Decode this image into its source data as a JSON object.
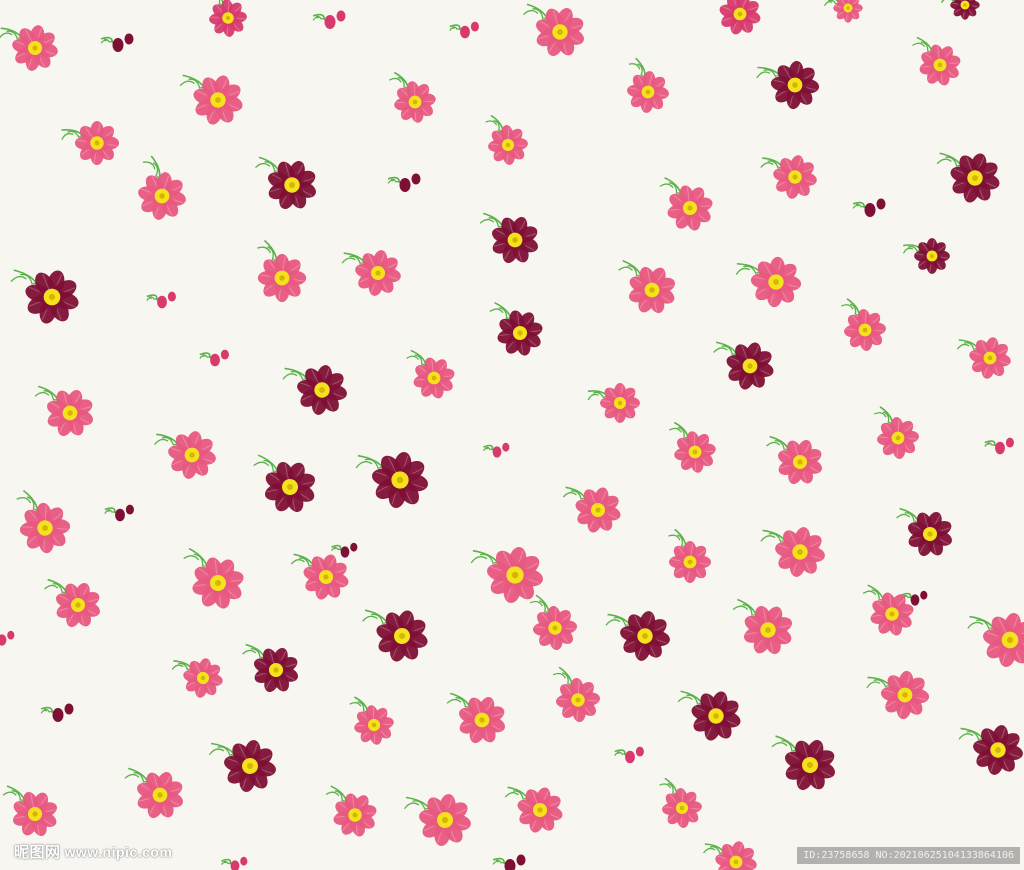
{
  "image": {
    "subject": "",
    "colors": {
      "background": "#f8f6f0",
      "pink": "#e8577f",
      "magenta": "#d83a6e",
      "crimson": "#7e0f35",
      "center": "#f5e21f",
      "stem": "#5bb24b"
    }
  },
  "watermark": {
    "site_name": "昵图网",
    "site_url": "www.nipic.com",
    "id_text": "ID:23758658 NO:20210625104133864106"
  }
}
